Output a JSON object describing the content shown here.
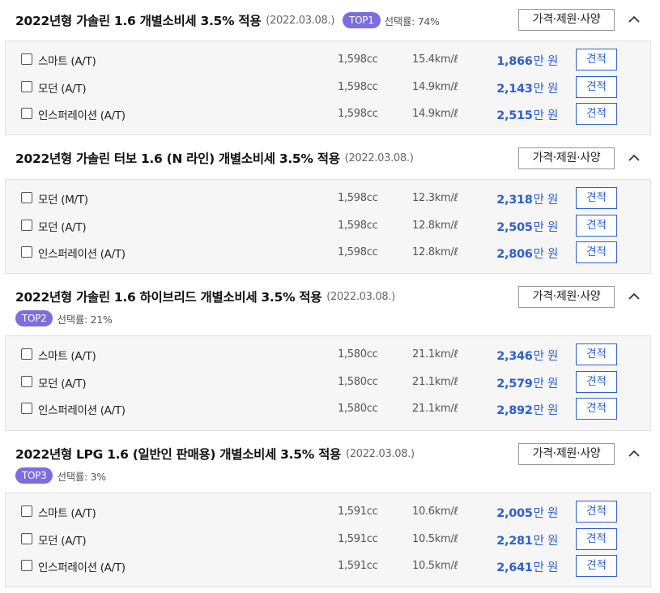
{
  "spec_label": "가격·제원·사양",
  "quote_label": "견적",
  "price_unit": "만 원",
  "sections": [
    {
      "title": "2022년형 가솔린 1.6 개별소비세 3.5% 적용",
      "date": "(2022.03.08.)",
      "top": "TOP1",
      "rate": "선택률: 74%",
      "rows": [
        {
          "trim": "스마트 (A/T)",
          "cc": "1,598cc",
          "eff": "15.4km/ℓ",
          "price": "1,866"
        },
        {
          "trim": "모던 (A/T)",
          "cc": "1,598cc",
          "eff": "14.9km/ℓ",
          "price": "2,143"
        },
        {
          "trim": "인스퍼레이션 (A/T)",
          "cc": "1,598cc",
          "eff": "14.9km/ℓ",
          "price": "2,515"
        }
      ]
    },
    {
      "title": "2022년형 가솔린 터보 1.6 (N 라인) 개별소비세 3.5% 적용",
      "date": "(2022.03.08.)",
      "top": "",
      "rate": "",
      "rows": [
        {
          "trim": "모던 (M/T)",
          "cc": "1,598cc",
          "eff": "12.3km/ℓ",
          "price": "2,318"
        },
        {
          "trim": "모던 (A/T)",
          "cc": "1,598cc",
          "eff": "12.8km/ℓ",
          "price": "2,505"
        },
        {
          "trim": "인스퍼레이션 (A/T)",
          "cc": "1,598cc",
          "eff": "12.8km/ℓ",
          "price": "2,806"
        }
      ]
    },
    {
      "title": "2022년형 가솔린 1.6 하이브리드 개별소비세 3.5% 적용",
      "date": "(2022.03.08.)",
      "top": "TOP2",
      "rate": "선택률: 21%",
      "rows": [
        {
          "trim": "스마트 (A/T)",
          "cc": "1,580cc",
          "eff": "21.1km/ℓ",
          "price": "2,346"
        },
        {
          "trim": "모던 (A/T)",
          "cc": "1,580cc",
          "eff": "21.1km/ℓ",
          "price": "2,579"
        },
        {
          "trim": "인스퍼레이션 (A/T)",
          "cc": "1,580cc",
          "eff": "21.1km/ℓ",
          "price": "2,892"
        }
      ]
    },
    {
      "title": "2022년형 LPG 1.6 (일반인 판매용) 개별소비세 3.5% 적용",
      "date": "(2022.03.08.)",
      "top": "TOP3",
      "rate": "선택률: 3%",
      "rows": [
        {
          "trim": "스마트 (A/T)",
          "cc": "1,591cc",
          "eff": "10.6km/ℓ",
          "price": "2,005"
        },
        {
          "trim": "모던 (A/T)",
          "cc": "1,591cc",
          "eff": "10.5km/ℓ",
          "price": "2,281"
        },
        {
          "trim": "인스퍼레이션 (A/T)",
          "cc": "1,591cc",
          "eff": "10.5km/ℓ",
          "price": "2,641"
        }
      ]
    }
  ]
}
